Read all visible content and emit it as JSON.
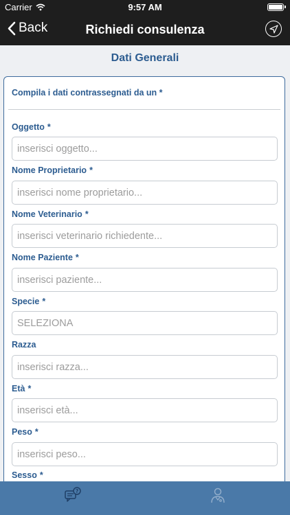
{
  "status_bar": {
    "carrier": "Carrier",
    "time": "9:57 AM"
  },
  "nav": {
    "back_label": "Back",
    "title": "Richiedi consulenza",
    "action_icon": "send-icon"
  },
  "section_title": "Dati Generali",
  "form": {
    "intro": "Compila i dati contrassegnati da un *",
    "fields": [
      {
        "label": "Oggetto",
        "required": "*",
        "placeholder": "inserisci oggetto..."
      },
      {
        "label": "Nome Proprietario",
        "required": "*",
        "placeholder": "inserisci nome proprietario..."
      },
      {
        "label": "Nome Veterinario",
        "required": "*",
        "placeholder": "inserisci veterinario richiedente..."
      },
      {
        "label": "Nome Paziente",
        "required": "*",
        "placeholder": "inserisci paziente..."
      },
      {
        "label": "Specie",
        "required": "*",
        "value": "SELEZIONA"
      },
      {
        "label": "Razza",
        "placeholder": "inserisci razza..."
      },
      {
        "label": "Età",
        "required": "*",
        "placeholder": "inserisci età..."
      },
      {
        "label": "Peso",
        "required": "*",
        "placeholder": "inserisci peso..."
      },
      {
        "label": "Sesso",
        "required": "*"
      }
    ]
  },
  "tabbar": {
    "items": [
      {
        "icon": "chat-question-icon",
        "active": true
      },
      {
        "icon": "doctor-icon",
        "active": false
      }
    ]
  },
  "colors": {
    "navbar": "#1e1e1e",
    "accent": "#2c5c90",
    "tabbar": "#4a79a8",
    "background": "#eef0f3"
  }
}
